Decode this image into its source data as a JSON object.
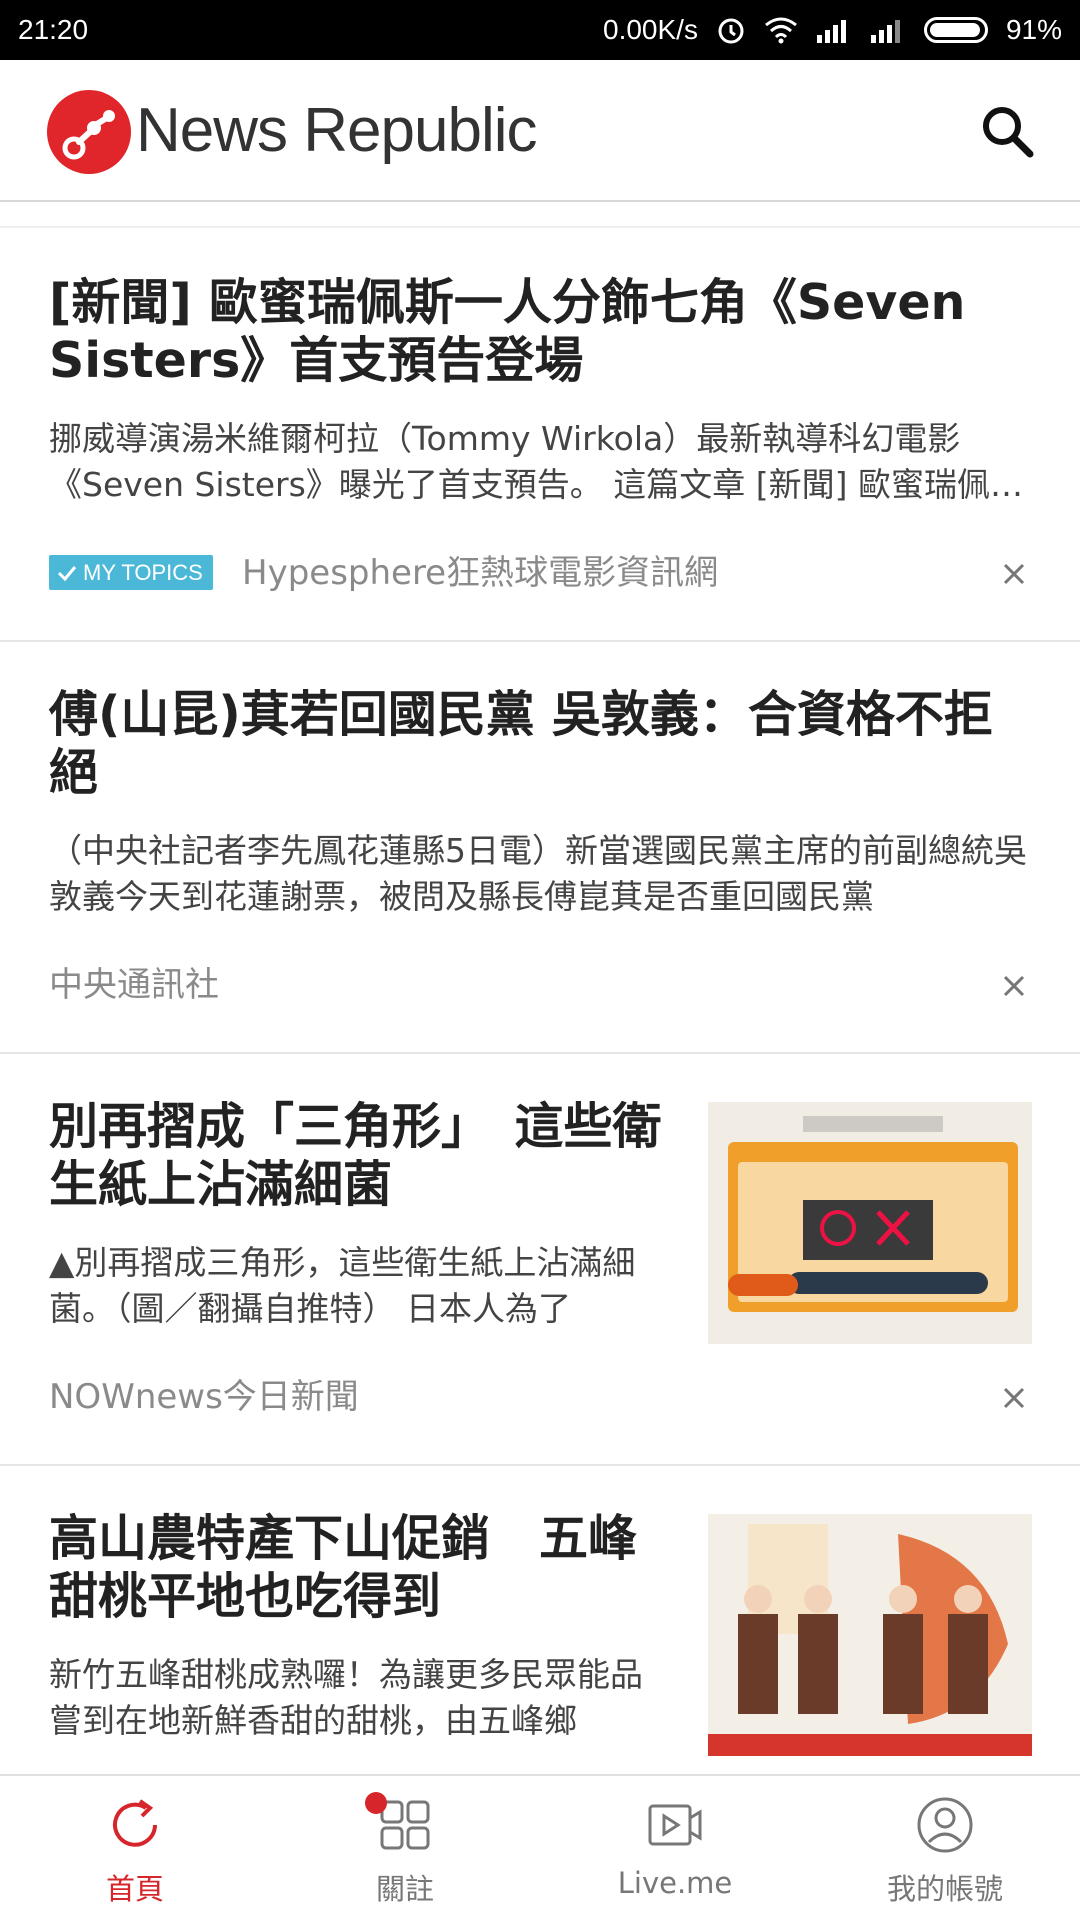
{
  "status_bar": {
    "time": "21:20",
    "speed": "0.00K/s",
    "battery": "91%"
  },
  "app": {
    "name": "News Republic",
    "brand_color": "#e0262b"
  },
  "feed": {
    "articles": [
      {
        "title": "[新聞] 歐蜜瑞佩斯一人分飾七角《Seven Sisters》首支預告登場",
        "summary": "挪威導演湯米維爾柯拉（Tommy Wirkola）最新執導科幻電影《Seven Sisters》曝光了首支預告。 這篇文章 [新聞] 歐蜜瑞佩斯一人分飾七角",
        "badge": "MY TOPICS",
        "source": "Hypesphere狂熱球電影資訊網"
      },
      {
        "title": "傅(山昆)萁若回國民黨 吳敦義：合資格不拒絕",
        "summary": "（中央社記者李先鳳花蓮縣5日電）新當選國民黨主席的前副總統吳敦義今天到花蓮謝票，被問及縣長傅崑萁是否重回國民黨",
        "source": "中央通訊社"
      },
      {
        "title": "別再摺成「三角形」　這些衛生紙上沾滿細菌",
        "summary": "▲別再摺成三角形，這些衛生紙上沾滿細菌。（圖／翻攝自推特） 日本人為了",
        "source": "NOWnews今日新聞"
      },
      {
        "title": "高山農特產下山促銷　五峰甜桃平地也吃得到",
        "summary": "新竹五峰甜桃成熟囉！為讓更多民眾能品嘗到在地新鮮香甜的甜桃，由五峰鄉",
        "source": ""
      }
    ]
  },
  "bottom_nav": {
    "items": [
      {
        "label": "首頁",
        "icon": "refresh-icon",
        "active": true
      },
      {
        "label": "關註",
        "icon": "grid-icon",
        "active": false
      },
      {
        "label": "Live.me",
        "icon": "video-play-icon",
        "active": false
      },
      {
        "label": "我的帳號",
        "icon": "user-icon",
        "active": false
      }
    ],
    "active_color": "#d7262b"
  }
}
